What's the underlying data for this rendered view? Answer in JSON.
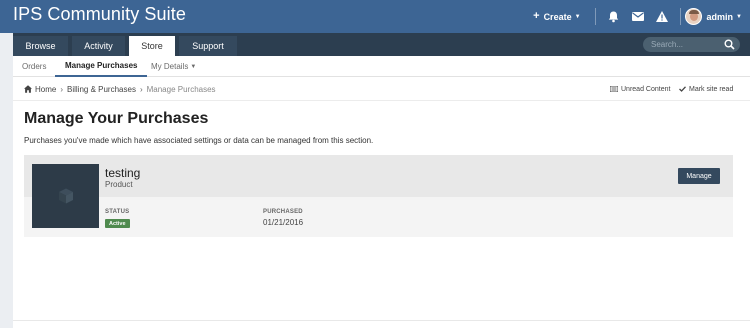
{
  "header": {
    "site_title": "IPS Community Suite",
    "create_label": "Create",
    "user_name": "admin",
    "icons": [
      "bell-icon",
      "envelope-icon",
      "warning-icon"
    ]
  },
  "nav": {
    "tabs": [
      {
        "label": "Browse",
        "active": false
      },
      {
        "label": "Activity",
        "active": false
      },
      {
        "label": "Store",
        "active": true
      },
      {
        "label": "Support",
        "active": false
      }
    ],
    "search_placeholder": "Search..."
  },
  "subnav": {
    "items": [
      {
        "label": "Orders",
        "active": false
      },
      {
        "label": "Manage Purchases",
        "active": true
      },
      {
        "label": "My Details",
        "active": false,
        "dropdown": true
      }
    ]
  },
  "breadcrumb": {
    "items": [
      "Home",
      "Billing & Purchases",
      "Manage Purchases"
    ],
    "unread_content": "Unread Content",
    "mark_read": "Mark site read"
  },
  "main": {
    "title": "Manage Your Purchases",
    "description": "Purchases you've made which have associated settings or data can be managed from this section."
  },
  "purchase": {
    "name": "testing",
    "type": "Product",
    "manage_label": "Manage",
    "status_label": "STATUS",
    "status_value": "Active",
    "purchased_label": "PURCHASED",
    "purchased_value": "01/21/2016"
  },
  "colors": {
    "header_bg": "#3d6594",
    "nav_bg": "#2c3e50",
    "button_bg": "#34495e",
    "status_active": "#4f8a4e"
  }
}
